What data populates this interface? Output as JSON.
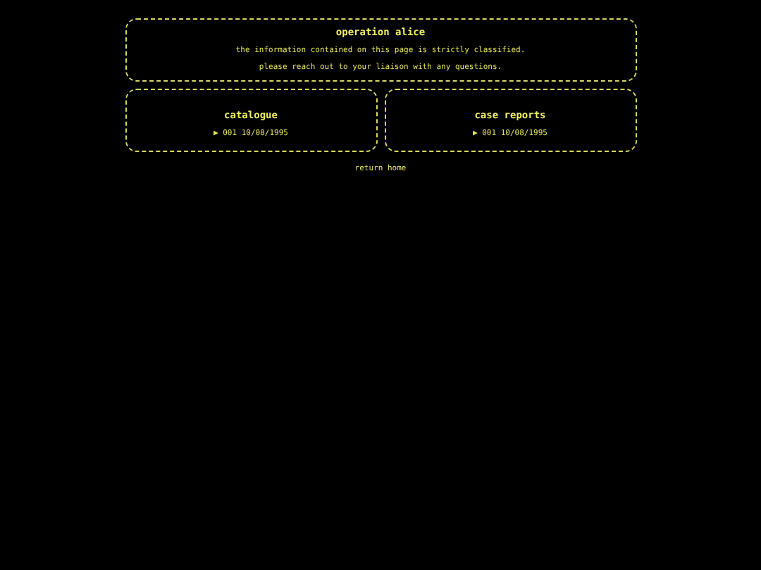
{
  "header": {
    "title": "operation alice",
    "lines": [
      "the information contained on this page is strictly classified.",
      "please reach out to your liaison with any questions."
    ]
  },
  "panels": [
    {
      "title": "catalogue",
      "entries": [
        "▶ 001 10/08/1995"
      ]
    },
    {
      "title": "case reports",
      "entries": [
        "▶ 001 10/08/1995"
      ]
    }
  ],
  "footer_link": "return home"
}
